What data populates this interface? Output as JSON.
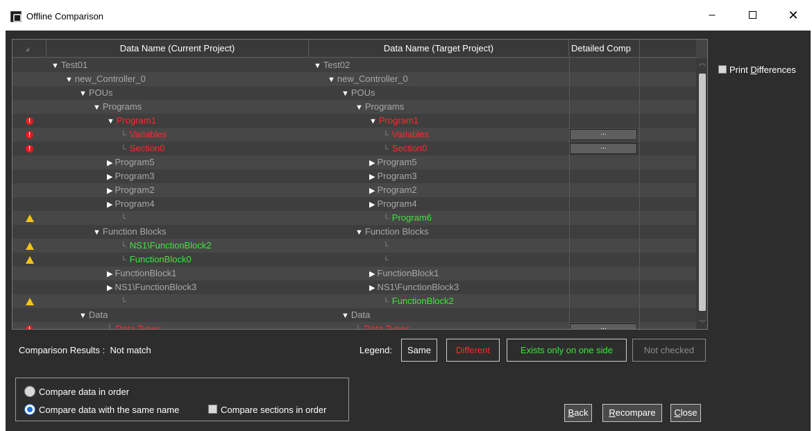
{
  "window": {
    "title": "Offline Comparison",
    "minimize": "–",
    "close": "✕"
  },
  "grid": {
    "columns": [
      "",
      "Data Name (Current Project)",
      "Data Name (Target Project)",
      "Detailed Comp",
      ""
    ],
    "detail_button_label": "...",
    "rows": [
      {
        "status": "",
        "indent_cur": 0,
        "cur_tri": "▼",
        "cur_text": "Test01",
        "cur_color": "gray",
        "indent_tgt": 0,
        "tgt_tri": "▼",
        "tgt_text": "Test02",
        "tgt_color": "gray",
        "detail": false
      },
      {
        "status": "",
        "indent_cur": 1,
        "cur_tri": "▼",
        "cur_text": "new_Controller_0",
        "cur_color": "gray",
        "indent_tgt": 1,
        "tgt_tri": "▼",
        "tgt_text": "new_Controller_0",
        "tgt_color": "gray",
        "detail": false
      },
      {
        "status": "",
        "indent_cur": 2,
        "cur_tri": "▼",
        "cur_text": "POUs",
        "cur_color": "gray",
        "indent_tgt": 2,
        "tgt_tri": "▼",
        "tgt_text": "POUs",
        "tgt_color": "gray",
        "detail": false
      },
      {
        "status": "",
        "indent_cur": 3,
        "cur_tri": "▼",
        "cur_text": "Programs",
        "cur_color": "gray",
        "indent_tgt": 3,
        "tgt_tri": "▼",
        "tgt_text": "Programs",
        "tgt_color": "gray",
        "detail": false
      },
      {
        "status": "error",
        "indent_cur": 4,
        "cur_tri": "▼",
        "cur_text": "Program1",
        "cur_color": "red",
        "indent_tgt": 4,
        "tgt_tri": "▼",
        "tgt_text": "Program1",
        "tgt_color": "red",
        "detail": false
      },
      {
        "status": "error",
        "indent_cur": 5,
        "cur_tri": "└",
        "cur_text": "Variables",
        "cur_color": "red",
        "indent_tgt": 5,
        "tgt_tri": "└",
        "tgt_text": "Variables",
        "tgt_color": "red",
        "detail": true
      },
      {
        "status": "error",
        "indent_cur": 5,
        "cur_tri": "└",
        "cur_text": "Section0",
        "cur_color": "red",
        "indent_tgt": 5,
        "tgt_tri": "└",
        "tgt_text": "Section0",
        "tgt_color": "red",
        "detail": true
      },
      {
        "status": "",
        "indent_cur": 4,
        "cur_tri": "▶",
        "cur_text": "Program5",
        "cur_color": "gray",
        "indent_tgt": 4,
        "tgt_tri": "▶",
        "tgt_text": "Program5",
        "tgt_color": "gray",
        "detail": false
      },
      {
        "status": "",
        "indent_cur": 4,
        "cur_tri": "▶",
        "cur_text": "Program3",
        "cur_color": "gray",
        "indent_tgt": 4,
        "tgt_tri": "▶",
        "tgt_text": "Program3",
        "tgt_color": "gray",
        "detail": false
      },
      {
        "status": "",
        "indent_cur": 4,
        "cur_tri": "▶",
        "cur_text": "Program2",
        "cur_color": "gray",
        "indent_tgt": 4,
        "tgt_tri": "▶",
        "tgt_text": "Program2",
        "tgt_color": "gray",
        "detail": false
      },
      {
        "status": "",
        "indent_cur": 4,
        "cur_tri": "▶",
        "cur_text": "Program4",
        "cur_color": "gray",
        "indent_tgt": 4,
        "tgt_tri": "▶",
        "tgt_text": "Program4",
        "tgt_color": "gray",
        "detail": false
      },
      {
        "status": "warning",
        "indent_cur": 5,
        "cur_tri": "└",
        "cur_text": "",
        "cur_color": "gray",
        "indent_tgt": 5,
        "tgt_tri": "└",
        "tgt_text": "Program6",
        "tgt_color": "green",
        "detail": false
      },
      {
        "status": "",
        "indent_cur": 3,
        "cur_tri": "▼",
        "cur_text": "Function Blocks",
        "cur_color": "gray",
        "indent_tgt": 3,
        "tgt_tri": "▼",
        "tgt_text": "Function Blocks",
        "tgt_color": "gray",
        "detail": false
      },
      {
        "status": "warning",
        "indent_cur": 5,
        "cur_tri": "└",
        "cur_text": "NS1\\FunctionBlock2",
        "cur_color": "green",
        "indent_tgt": 5,
        "tgt_tri": "└",
        "tgt_text": "",
        "tgt_color": "gray",
        "detail": false
      },
      {
        "status": "warning",
        "indent_cur": 5,
        "cur_tri": "└",
        "cur_text": "FunctionBlock0",
        "cur_color": "green",
        "indent_tgt": 5,
        "tgt_tri": "└",
        "tgt_text": "",
        "tgt_color": "gray",
        "detail": false
      },
      {
        "status": "",
        "indent_cur": 4,
        "cur_tri": "▶",
        "cur_text": "FunctionBlock1",
        "cur_color": "gray",
        "indent_tgt": 4,
        "tgt_tri": "▶",
        "tgt_text": "FunctionBlock1",
        "tgt_color": "gray",
        "detail": false
      },
      {
        "status": "",
        "indent_cur": 4,
        "cur_tri": "▶",
        "cur_text": "NS1\\FunctionBlock3",
        "cur_color": "gray",
        "indent_tgt": 4,
        "tgt_tri": "▶",
        "tgt_text": "NS1\\FunctionBlock3",
        "tgt_color": "gray",
        "detail": false
      },
      {
        "status": "warning",
        "indent_cur": 5,
        "cur_tri": "└",
        "cur_text": "",
        "cur_color": "gray",
        "indent_tgt": 5,
        "tgt_tri": "└",
        "tgt_text": "FunctionBlock2",
        "tgt_color": "green",
        "detail": false
      },
      {
        "status": "",
        "indent_cur": 2,
        "cur_tri": "▼",
        "cur_text": "Data",
        "cur_color": "gray",
        "indent_tgt": 2,
        "tgt_tri": "▼",
        "tgt_text": "Data",
        "tgt_color": "gray",
        "detail": false
      },
      {
        "status": "error",
        "indent_cur": 4,
        "cur_tri": "└",
        "cur_text": "Data Types",
        "cur_color": "red",
        "indent_tgt": 3,
        "tgt_tri": "└",
        "tgt_text": "Data Types",
        "tgt_color": "red",
        "detail": true
      }
    ]
  },
  "print_differences": {
    "label_pre": "Print ",
    "label_u": "D",
    "label_post": "ifferences",
    "checked": false
  },
  "results": {
    "label": "Comparison Results :",
    "value": "Not match"
  },
  "legend": {
    "label": "Legend:",
    "same": "Same",
    "different": "Different",
    "one_side": "Exists only on one side",
    "not_checked": "Not checked"
  },
  "options": {
    "compare_in_order": "Compare data in order",
    "compare_same_name": "Compare data with the same name",
    "compare_sections": "Compare sections in order",
    "selected": "compare_same_name"
  },
  "buttons": {
    "back_u": "B",
    "back_rest": "ack",
    "recompare_u": "R",
    "recompare_rest": "ecompare",
    "close_u": "C",
    "close_rest": "lose"
  },
  "colors": {
    "red": "#ff2a2a",
    "green": "#3ee63e",
    "gray": "#a8a8a8",
    "background": "#2d2d2d"
  }
}
